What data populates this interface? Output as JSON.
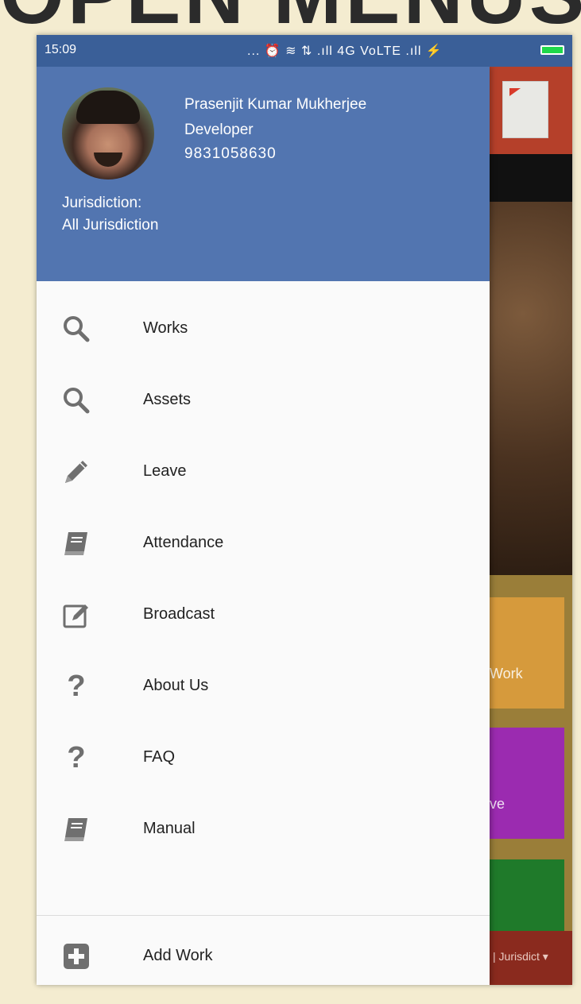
{
  "slide": {
    "title": "OPEN MENUS"
  },
  "status_bar": {
    "time": "15:09",
    "indicators": "... ⏰ ≋ ⇅ .ıll 4G VoLTE .ıll ⚡",
    "battery_color": "#1fd84a"
  },
  "drawer": {
    "header": {
      "name": "Prasenjit Kumar Mukherjee",
      "role": "Developer",
      "phone": "9831058630",
      "jurisdiction_label": "Jurisdiction:",
      "jurisdiction_value": "All Jurisdiction",
      "bg_color": "#5275b0"
    },
    "menu": [
      {
        "label": "Works",
        "icon": "search-icon"
      },
      {
        "label": "Assets",
        "icon": "search-icon"
      },
      {
        "label": "Leave",
        "icon": "pencil-icon"
      },
      {
        "label": "Attendance",
        "icon": "book-icon"
      },
      {
        "label": "Broadcast",
        "icon": "edit-icon"
      },
      {
        "label": "About Us",
        "icon": "question-icon"
      },
      {
        "label": "FAQ",
        "icon": "question-icon"
      },
      {
        "label": "Manual",
        "icon": "book-icon"
      }
    ],
    "add_work": {
      "label": "Add Work",
      "icon": "plus-square-icon"
    }
  },
  "background_app": {
    "tile_orange_label": "Work",
    "tile_purple_label": "ve",
    "bottom_bar_text": "| Jurisdict ▾"
  }
}
